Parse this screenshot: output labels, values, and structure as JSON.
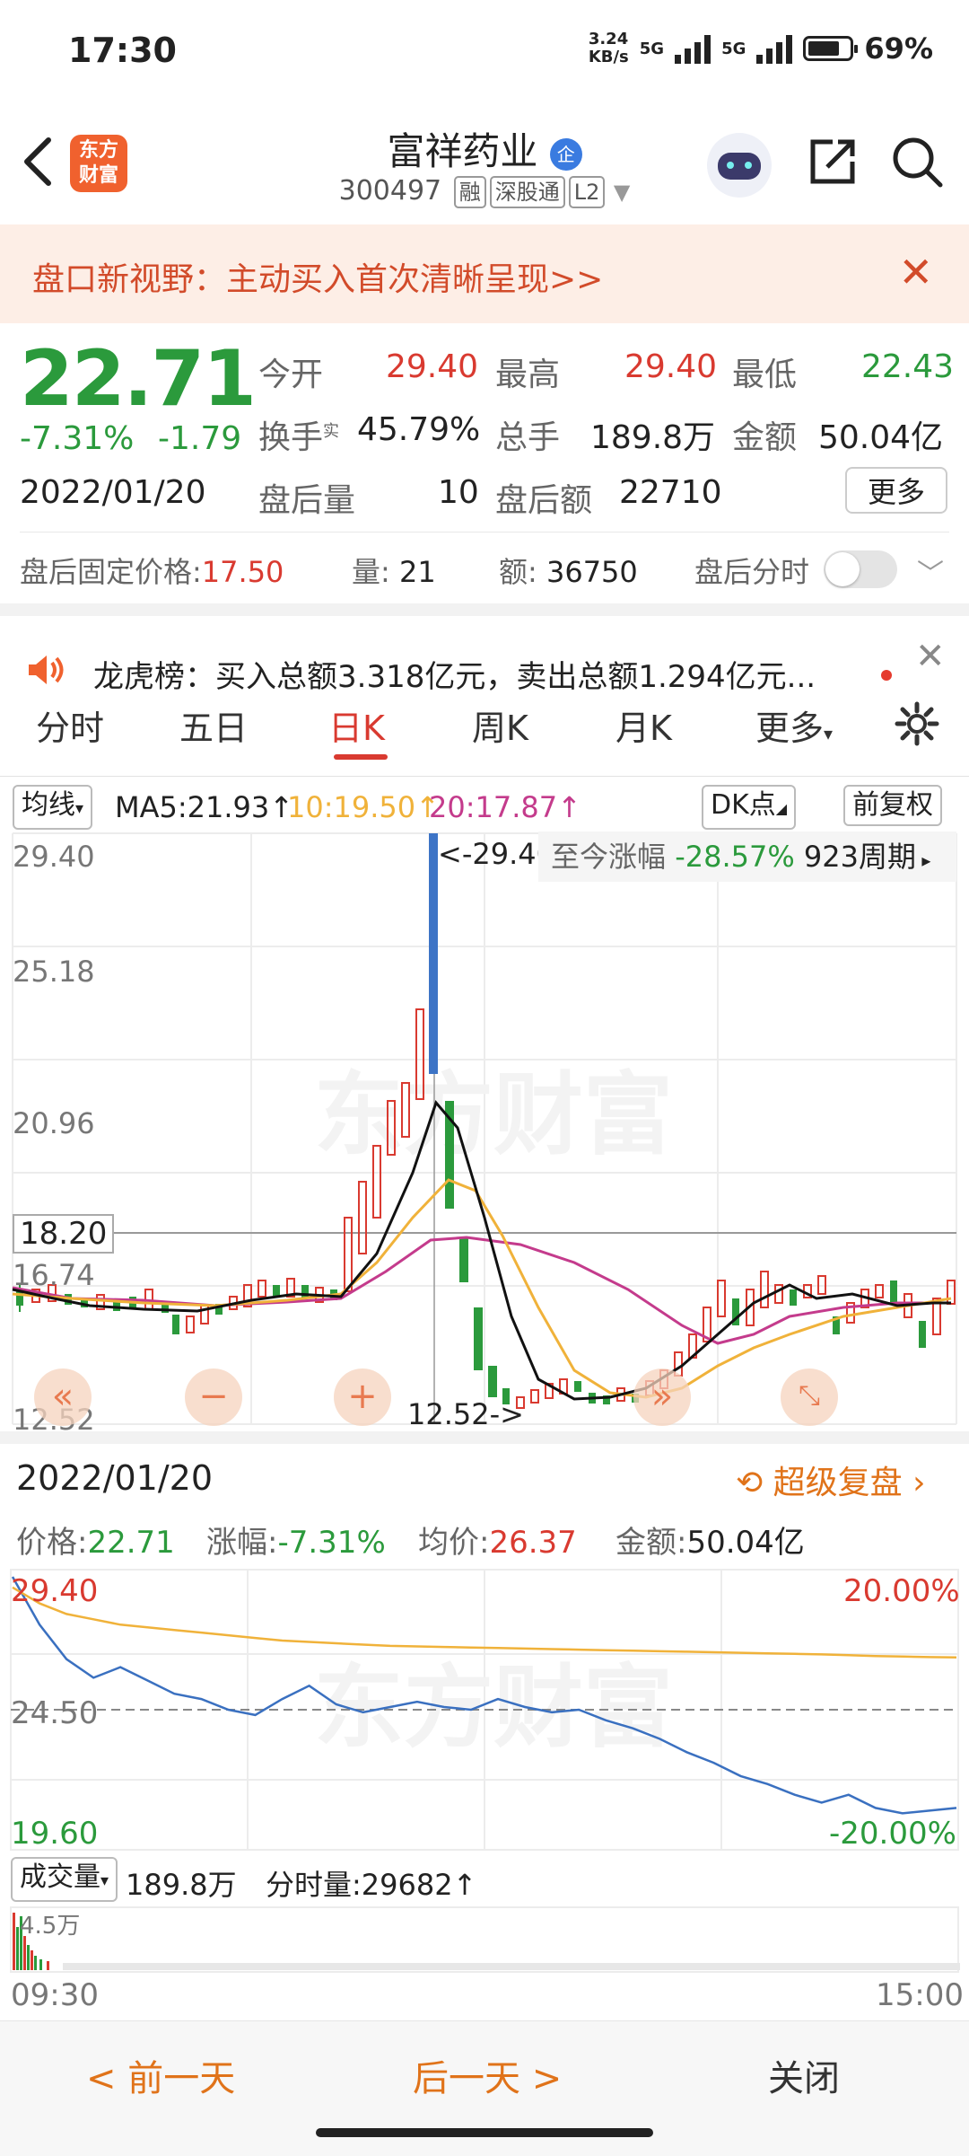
{
  "status": {
    "time": "17:30",
    "net_speed": "3.24\nKB/s",
    "sig1": "5G",
    "sig2": "5G",
    "battery": "69%"
  },
  "header": {
    "logo": "东方\n财富",
    "stock_name": "富祥药业",
    "badge": "企",
    "code": "300497",
    "tags": [
      "融",
      "深股通",
      "L2"
    ]
  },
  "banner": {
    "text": "盘口新视野：主动买入首次清晰呈现>>"
  },
  "quote": {
    "price": "22.71",
    "change_pct": "-7.31%",
    "change": "-1.79",
    "date": "2022/01/20",
    "open_label": "今开",
    "open": "29.40",
    "high_label": "最高",
    "high": "29.40",
    "low_label": "最低",
    "low": "22.43",
    "turnover_label": "换手",
    "turnover_sup": "实",
    "turnover": "45.79%",
    "volume_label": "总手",
    "volume": "189.8万",
    "amount_label": "金额",
    "amount": "50.04亿",
    "ah_vol_label": "盘后量",
    "ah_vol": "10",
    "ah_amt_label": "盘后额",
    "ah_amt": "22710",
    "more_label": "更多"
  },
  "after_hours": {
    "fixed_label": "盘后固定价格:",
    "fixed_price": "17.50",
    "qty_label": "量:",
    "qty": "21",
    "amt_label": "额:",
    "amt": "36750",
    "timeshare_label": "盘后分时"
  },
  "news": {
    "text": "龙虎榜：买入总额3.318亿元，卖出总额1.294亿元..."
  },
  "tabs": [
    "分时",
    "五日",
    "日K",
    "周K",
    "月K",
    "更多"
  ],
  "kline": {
    "ma_selector": "均线",
    "ma5": "MA5:21.93↑",
    "ma10": "10:19.50↑",
    "ma20": "20:17.87↑",
    "dk": "DK点",
    "adjust": "前复权",
    "y_labels": [
      "29.40",
      "25.18",
      "20.96",
      "16.74",
      "12.52"
    ],
    "current_label": "18.20",
    "high_marker": "<-29.40",
    "low_marker": "12.52->",
    "since_label": "至今涨幅",
    "since_value": "-28.57%",
    "period": "923周期",
    "watermark": "东方财富"
  },
  "intraday": {
    "date": "2022/01/20",
    "replay": "超级复盘",
    "price_label": "价格:",
    "price": "22.71",
    "chg_label": "涨幅:",
    "chg": "-7.31%",
    "avg_label": "均价:",
    "avg": "26.37",
    "amt_label": "金额:",
    "amt": "50.04亿",
    "y_top": "29.40",
    "y_mid": "24.50",
    "y_bot": "19.60",
    "pct_top": "20.00%",
    "pct_bot": "-20.00%",
    "vol_selector": "成交量",
    "vol_total": "189.8万",
    "vol_minute": "分时量:29682↑",
    "vol_scale": "4.5万",
    "t_start": "09:30",
    "t_end": "15:00"
  },
  "chart_data": {
    "type": "line",
    "title": "",
    "y_range": [
      19.6,
      29.4
    ],
    "series": [
      {
        "name": "价格",
        "values": [
          29.4,
          27.6,
          26.3,
          25.6,
          26.0,
          25.5,
          25.0,
          24.8,
          24.4,
          24.2,
          24.8,
          25.3,
          24.6,
          24.3,
          24.5,
          24.7,
          24.5,
          24.4,
          24.8,
          24.5,
          24.3,
          24.4,
          24.0,
          23.7,
          23.3,
          22.8,
          22.4,
          21.9,
          21.6,
          21.2,
          20.9,
          21.2,
          20.7,
          20.5,
          20.6,
          20.7
        ]
      },
      {
        "values": [
          29.0,
          28.4,
          28.0,
          27.8,
          27.6,
          27.5,
          27.4,
          27.3,
          27.2,
          27.1,
          27.0,
          26.95,
          26.9,
          26.85,
          26.8,
          26.78,
          26.76,
          26.74,
          26.72,
          26.7,
          26.68,
          26.66,
          26.64,
          26.62,
          26.6,
          26.58,
          26.56,
          26.54,
          26.52,
          26.5,
          26.48,
          26.45,
          26.42,
          26.4,
          26.38,
          26.37
        ]
      }
    ]
  },
  "footer": {
    "prev": "< 前一天",
    "next": "后一天 >",
    "close": "关闭"
  }
}
